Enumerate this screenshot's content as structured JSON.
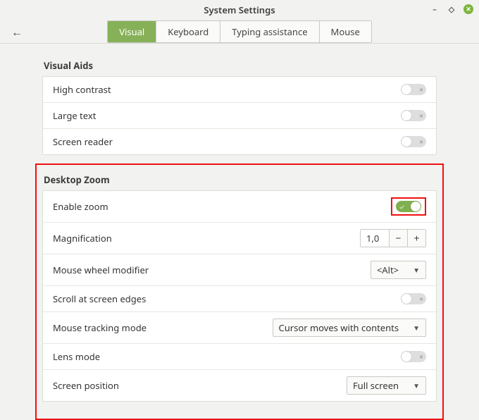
{
  "window": {
    "title": "System Settings"
  },
  "tabs": {
    "visual": "Visual",
    "keyboard": "Keyboard",
    "typing": "Typing assistance",
    "mouse": "Mouse"
  },
  "sections": {
    "visual_aids": {
      "title": "Visual Aids",
      "rows": {
        "high_contrast": "High contrast",
        "large_text": "Large text",
        "screen_reader": "Screen reader"
      }
    },
    "desktop_zoom": {
      "title": "Desktop Zoom",
      "rows": {
        "enable_zoom": "Enable zoom",
        "magnification": "Magnification",
        "mouse_wheel_modifier": "Mouse wheel modifier",
        "scroll_edges": "Scroll at screen edges",
        "tracking_mode": "Mouse tracking mode",
        "lens_mode": "Lens mode",
        "screen_position": "Screen position"
      },
      "values": {
        "enable_zoom": true,
        "magnification": "1,0",
        "mouse_wheel_modifier": "<Alt>",
        "scroll_edges": false,
        "tracking_mode": "Cursor moves with contents",
        "lens_mode": false,
        "screen_position": "Full screen"
      }
    }
  }
}
